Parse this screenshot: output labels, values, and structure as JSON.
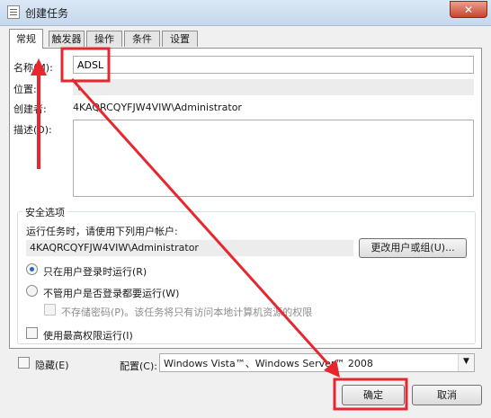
{
  "window": {
    "title": "创建任务",
    "close_glyph": "✕"
  },
  "tabs": [
    {
      "label": "常规",
      "active": true
    },
    {
      "label": "触发器",
      "active": false
    },
    {
      "label": "操作",
      "active": false
    },
    {
      "label": "条件",
      "active": false
    },
    {
      "label": "设置",
      "active": false
    }
  ],
  "general": {
    "name_label": "名称(M):",
    "name_value": "ADSL",
    "location_label": "位置:",
    "location_value": "\\",
    "author_label": "创建者:",
    "author_value": "4KAQRCQYFJW4VIW\\Administrator",
    "description_label": "描述(D):",
    "description_value": ""
  },
  "security": {
    "group_title": "安全选项",
    "run_as_label": "运行任务时，请使用下列用户帐户:",
    "run_as_value": "4KAQRCQYFJW4VIW\\Administrator",
    "change_user_button": "更改用户或组(U)...",
    "radio_logged_on": "只在用户登录时运行(R)",
    "radio_logged_on_checked": true,
    "radio_whether": "不管用户是否登录都要运行(W)",
    "radio_whether_checked": false,
    "no_store_password": "不存储密码(P)。该任务将只有访问本地计算机资源的权限",
    "highest_privileges": "使用最高权限运行(I)"
  },
  "footer": {
    "hidden_label": "隐藏(E)",
    "configure_label": "配置(C):",
    "configure_value": "Windows Vista™、Windows Server™ 2008",
    "ok_button": "确定",
    "cancel_button": "取消"
  },
  "annotation": {
    "color": "#e8262e"
  }
}
